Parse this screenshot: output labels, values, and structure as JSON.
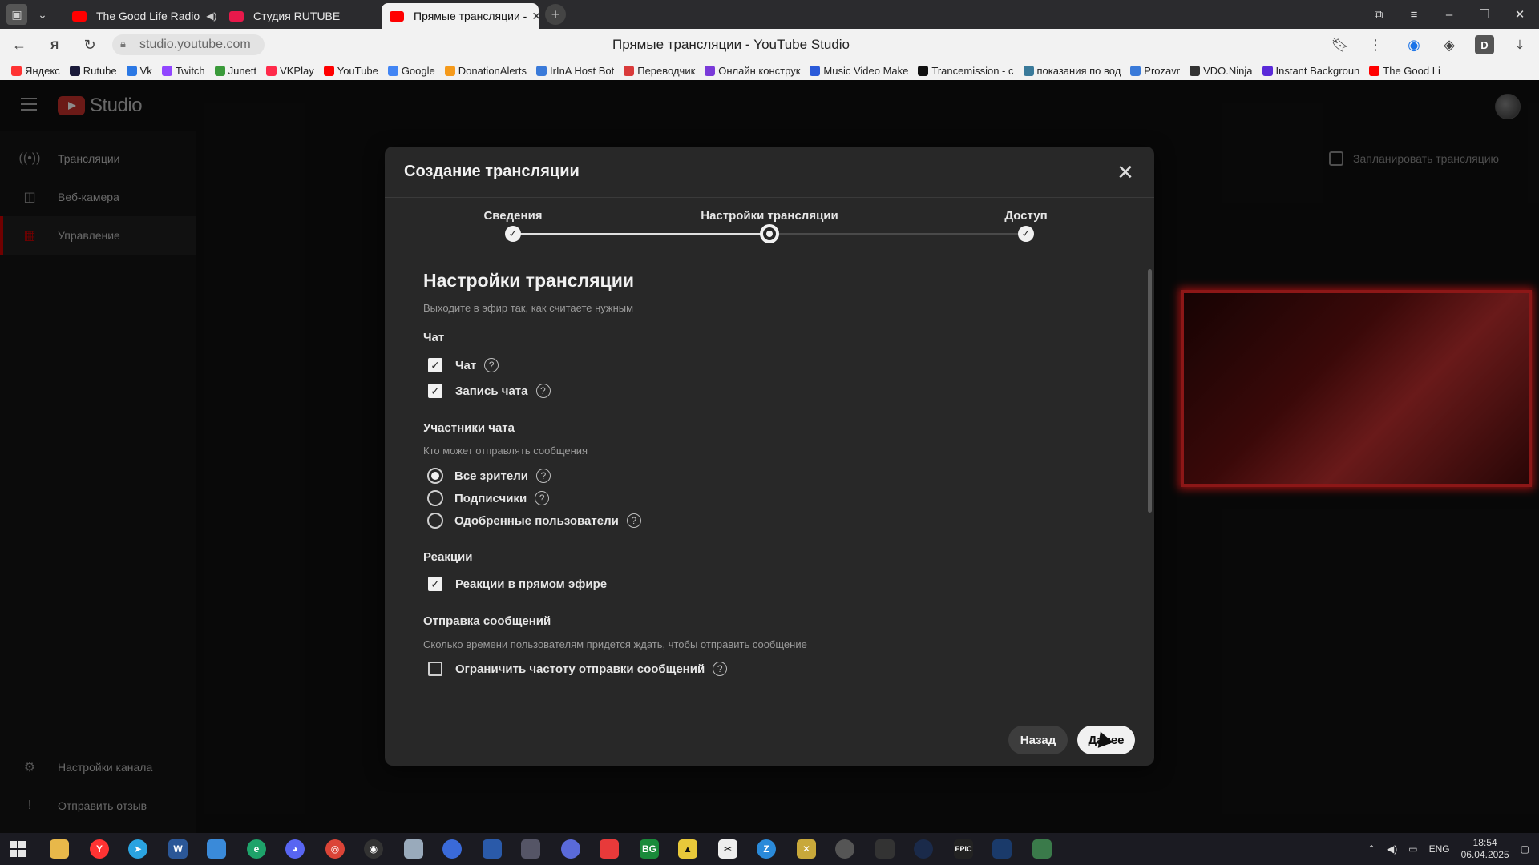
{
  "browser": {
    "tabs": [
      {
        "label": "The Good Life Radio",
        "color": "#ff0000"
      },
      {
        "label": "Студия RUTUBE",
        "color": "#e8194b"
      },
      {
        "label": "Прямые трансляции -",
        "color": "#ff0000"
      }
    ],
    "url": "studio.youtube.com",
    "page_title": "Прямые трансляции - YouTube Studio",
    "bookmarks": [
      {
        "label": "Яндекс",
        "color": "#ff3333"
      },
      {
        "label": "Rutube",
        "color": "#1a1a3a"
      },
      {
        "label": "Vk",
        "color": "#2b78e4"
      },
      {
        "label": "Twitch",
        "color": "#9146ff"
      },
      {
        "label": "Junett",
        "color": "#3a9a3a"
      },
      {
        "label": "VKPlay",
        "color": "#ff2a4a"
      },
      {
        "label": "YouTube",
        "color": "#ff0000"
      },
      {
        "label": "Google",
        "color": "#4285f4"
      },
      {
        "label": "DonationAlerts",
        "color": "#f59a1b"
      },
      {
        "label": "IrInA Host Bot",
        "color": "#3a7ad9"
      },
      {
        "label": "Переводчик",
        "color": "#d93a3a"
      },
      {
        "label": "Онлайн конструк",
        "color": "#7a3ad9"
      },
      {
        "label": "Music Video Make",
        "color": "#2a5ad9"
      },
      {
        "label": "Trancemission - c",
        "color": "#111111"
      },
      {
        "label": "показания по вод",
        "color": "#3a7a9a"
      },
      {
        "label": "Prozavr",
        "color": "#3a7ad9"
      },
      {
        "label": "VDO.Ninja",
        "color": "#333333"
      },
      {
        "label": "Instant Backgroun",
        "color": "#5a2ad9"
      },
      {
        "label": "The Good Li",
        "color": "#ff0000"
      }
    ]
  },
  "studio": {
    "logo_text": "Studio",
    "sidebar": {
      "items": [
        {
          "label": "Трансляции",
          "icon": "broadcast-icon"
        },
        {
          "label": "Веб-камера",
          "icon": "camera-icon"
        },
        {
          "label": "Управление",
          "icon": "calendar-icon"
        }
      ],
      "bottom": [
        {
          "label": "Настройки канала",
          "icon": "gear-icon"
        },
        {
          "label": "Отправить отзыв",
          "icon": "feedback-icon"
        }
      ]
    },
    "schedule_label": "Запланировать трансляцию"
  },
  "dialog": {
    "title": "Создание трансляции",
    "steps": [
      {
        "label": "Сведения",
        "state": "done"
      },
      {
        "label": "Настройки трансляции",
        "state": "current"
      },
      {
        "label": "Доступ",
        "state": "done"
      }
    ],
    "heading": "Настройки трансляции",
    "subheading": "Выходите в эфир так, как считаете нужным",
    "chat": {
      "section": "Чат",
      "options": [
        {
          "label": "Чат",
          "checked": true
        },
        {
          "label": "Запись чата",
          "checked": true
        }
      ]
    },
    "participants": {
      "section": "Участники чата",
      "hint": "Кто может отправлять сообщения",
      "options": [
        {
          "label": "Все зрители",
          "selected": true
        },
        {
          "label": "Подписчики",
          "selected": false
        },
        {
          "label": "Одобренные пользователи",
          "selected": false
        }
      ]
    },
    "reactions": {
      "section": "Реакции",
      "option": {
        "label": "Реакции в прямом эфире",
        "checked": true
      }
    },
    "messages": {
      "section": "Отправка сообщений",
      "hint": "Сколько времени пользователям придется ждать, чтобы отправить сообщение",
      "option": {
        "label": "Ограничить частоту отправки сообщений",
        "checked": false
      }
    },
    "back_label": "Назад",
    "next_label": "Далее"
  },
  "taskbar": {
    "lang": "ENG",
    "time": "18:54",
    "date": "06.04.2025"
  }
}
